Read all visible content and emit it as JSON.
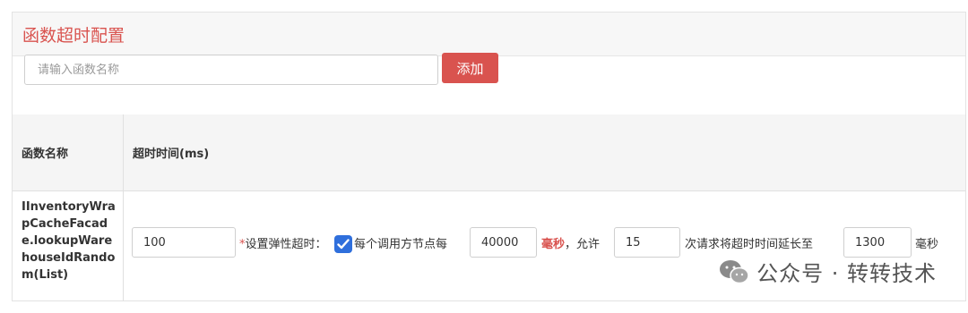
{
  "panel": {
    "title": "函数超时配置"
  },
  "search": {
    "placeholder": "请输入函数名称",
    "add_label": "添加"
  },
  "table": {
    "headers": [
      "函数名称",
      "超时时间(ms)"
    ],
    "row": {
      "function_name": "IInventoryWrapCacheFacade.lookupWarehouseIdRandom(List)",
      "timeout_value": "100",
      "required_mark": "*",
      "elastic_label": "设置弹性超时：",
      "elastic_checked": true,
      "per_call_label": "每个调用方节点每",
      "window_value": "40000",
      "ms_unit_red": "毫秒",
      "allow_label": "，允许",
      "count_value": "15",
      "extend_label": "次请求将超时时间延长至",
      "extended_value": "1300",
      "ms_unit": "毫秒"
    }
  },
  "watermark": {
    "text": "公众号 · 转转技术",
    "icon": "wechat-icon"
  },
  "colors": {
    "accent": "#d9534f",
    "checkbox": "#2f6fdc"
  }
}
